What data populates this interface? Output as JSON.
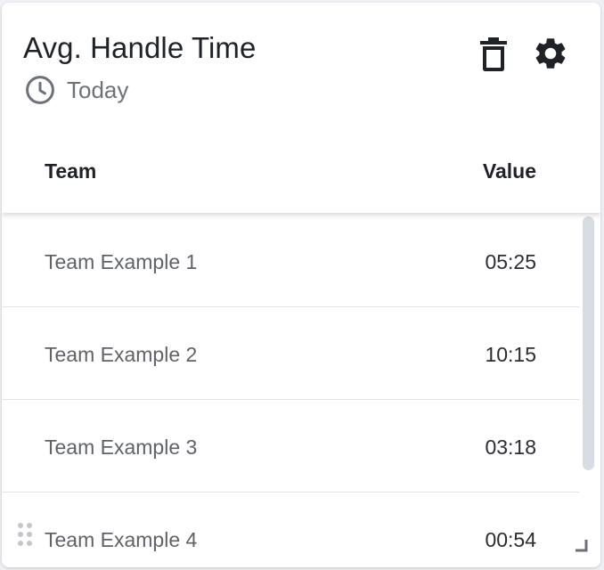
{
  "widget": {
    "title": "Avg. Handle Time",
    "period": "Today",
    "icons": {
      "period": "clock-icon",
      "delete": "trash-icon",
      "settings": "gear-icon",
      "drag": "drag-handle-icon",
      "resize": "resize-icon"
    }
  },
  "table": {
    "columns": [
      "Team",
      "Value"
    ],
    "rows": [
      {
        "team": "Team Example 1",
        "value": "05:25"
      },
      {
        "team": "Team Example 2",
        "value": "10:15"
      },
      {
        "team": "Team Example 3",
        "value": "03:18"
      },
      {
        "team": "Team Example 4",
        "value": "00:54"
      }
    ]
  },
  "colors": {
    "title": "#1f2328",
    "muted": "#6d7178",
    "icon": "#1f2328",
    "scrollbar": "#d8dde4",
    "divider": "#e2e4e7"
  }
}
